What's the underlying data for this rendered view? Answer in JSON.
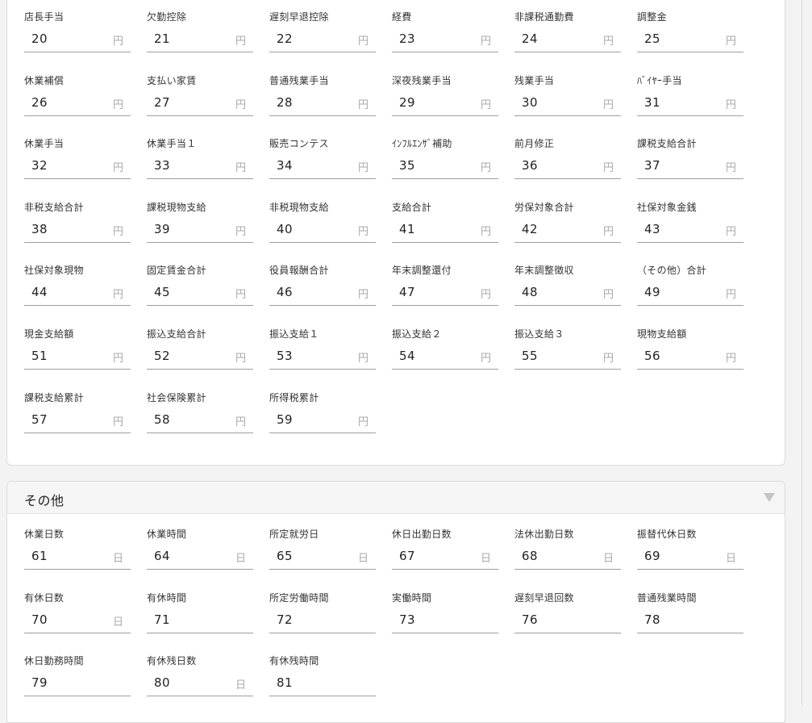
{
  "sections": [
    {
      "title": "",
      "rows": [
        [
          {
            "label": "店長手当",
            "value": "20",
            "unit": "円"
          },
          {
            "label": "欠勤控除",
            "value": "21",
            "unit": "円"
          },
          {
            "label": "遅刻早退控除",
            "value": "22",
            "unit": "円"
          },
          {
            "label": "経費",
            "value": "23",
            "unit": "円"
          },
          {
            "label": "非課税通勤費",
            "value": "24",
            "unit": "円"
          },
          {
            "label": "調整金",
            "value": "25",
            "unit": "円"
          }
        ],
        [
          {
            "label": "休業補償",
            "value": "26",
            "unit": "円"
          },
          {
            "label": "支払い家賃",
            "value": "27",
            "unit": "円"
          },
          {
            "label": "普通残業手当",
            "value": "28",
            "unit": "円"
          },
          {
            "label": "深夜残業手当",
            "value": "29",
            "unit": "円"
          },
          {
            "label": "残業手当",
            "value": "30",
            "unit": "円"
          },
          {
            "label": "ﾊﾞｲﾔｰ手当",
            "value": "31",
            "unit": "円"
          }
        ],
        [
          {
            "label": "休業手当",
            "value": "32",
            "unit": "円"
          },
          {
            "label": "休業手当１",
            "value": "33",
            "unit": "円"
          },
          {
            "label": "販売コンテス",
            "value": "34",
            "unit": "円"
          },
          {
            "label": "ｲﾝﾌﾙｴﾝｻﾞ補助",
            "value": "35",
            "unit": "円"
          },
          {
            "label": "前月修正",
            "value": "36",
            "unit": "円"
          },
          {
            "label": "課税支給合計",
            "value": "37",
            "unit": "円"
          }
        ],
        [
          {
            "label": "非税支給合計",
            "value": "38",
            "unit": "円"
          },
          {
            "label": "課税現物支給",
            "value": "39",
            "unit": "円"
          },
          {
            "label": "非税現物支給",
            "value": "40",
            "unit": "円"
          },
          {
            "label": "支給合計",
            "value": "41",
            "unit": "円"
          },
          {
            "label": "労保対象合計",
            "value": "42",
            "unit": "円"
          },
          {
            "label": "社保対象金銭",
            "value": "43",
            "unit": "円"
          }
        ],
        [
          {
            "label": "社保対象現物",
            "value": "44",
            "unit": "円"
          },
          {
            "label": "固定賃金合計",
            "value": "45",
            "unit": "円"
          },
          {
            "label": "役員報酬合計",
            "value": "46",
            "unit": "円"
          },
          {
            "label": "年末調整還付",
            "value": "47",
            "unit": "円"
          },
          {
            "label": "年末調整徴収",
            "value": "48",
            "unit": "円"
          },
          {
            "label": "（その他）合計",
            "value": "49",
            "unit": "円"
          }
        ],
        [
          {
            "label": "現金支給額",
            "value": "51",
            "unit": "円"
          },
          {
            "label": "振込支給合計",
            "value": "52",
            "unit": "円"
          },
          {
            "label": "振込支給１",
            "value": "53",
            "unit": "円"
          },
          {
            "label": "振込支給２",
            "value": "54",
            "unit": "円"
          },
          {
            "label": "振込支給３",
            "value": "55",
            "unit": "円"
          },
          {
            "label": "現物支給額",
            "value": "56",
            "unit": "円"
          }
        ],
        [
          {
            "label": "課税支給累計",
            "value": "57",
            "unit": "円"
          },
          {
            "label": "社会保険累計",
            "value": "58",
            "unit": "円"
          },
          {
            "label": "所得税累計",
            "value": "59",
            "unit": "円"
          }
        ]
      ]
    },
    {
      "title": "その他",
      "collapse_icon": "triangle-down-icon",
      "rows": [
        [
          {
            "label": "休業日数",
            "value": "61",
            "unit": "日"
          },
          {
            "label": "休業時間",
            "value": "64",
            "unit": "日"
          },
          {
            "label": "所定就労日",
            "value": "65",
            "unit": "日"
          },
          {
            "label": "休日出勤日数",
            "value": "67",
            "unit": "日"
          },
          {
            "label": "法休出勤日数",
            "value": "68",
            "unit": "日"
          },
          {
            "label": "振替代休日数",
            "value": "69",
            "unit": "日"
          }
        ],
        [
          {
            "label": "有休日数",
            "value": "70",
            "unit": "日"
          },
          {
            "label": "有休時間",
            "value": "71",
            "unit": ""
          },
          {
            "label": "所定労働時間",
            "value": "72",
            "unit": ""
          },
          {
            "label": "実働時間",
            "value": "73",
            "unit": ""
          },
          {
            "label": "遅刻早退回数",
            "value": "76",
            "unit": ""
          },
          {
            "label": "普通残業時間",
            "value": "78",
            "unit": ""
          }
        ],
        [
          {
            "label": "休日勤務時間",
            "value": "79",
            "unit": ""
          },
          {
            "label": "有休残日数",
            "value": "80",
            "unit": "日"
          },
          {
            "label": "有休残時間",
            "value": "81",
            "unit": ""
          }
        ]
      ]
    }
  ]
}
